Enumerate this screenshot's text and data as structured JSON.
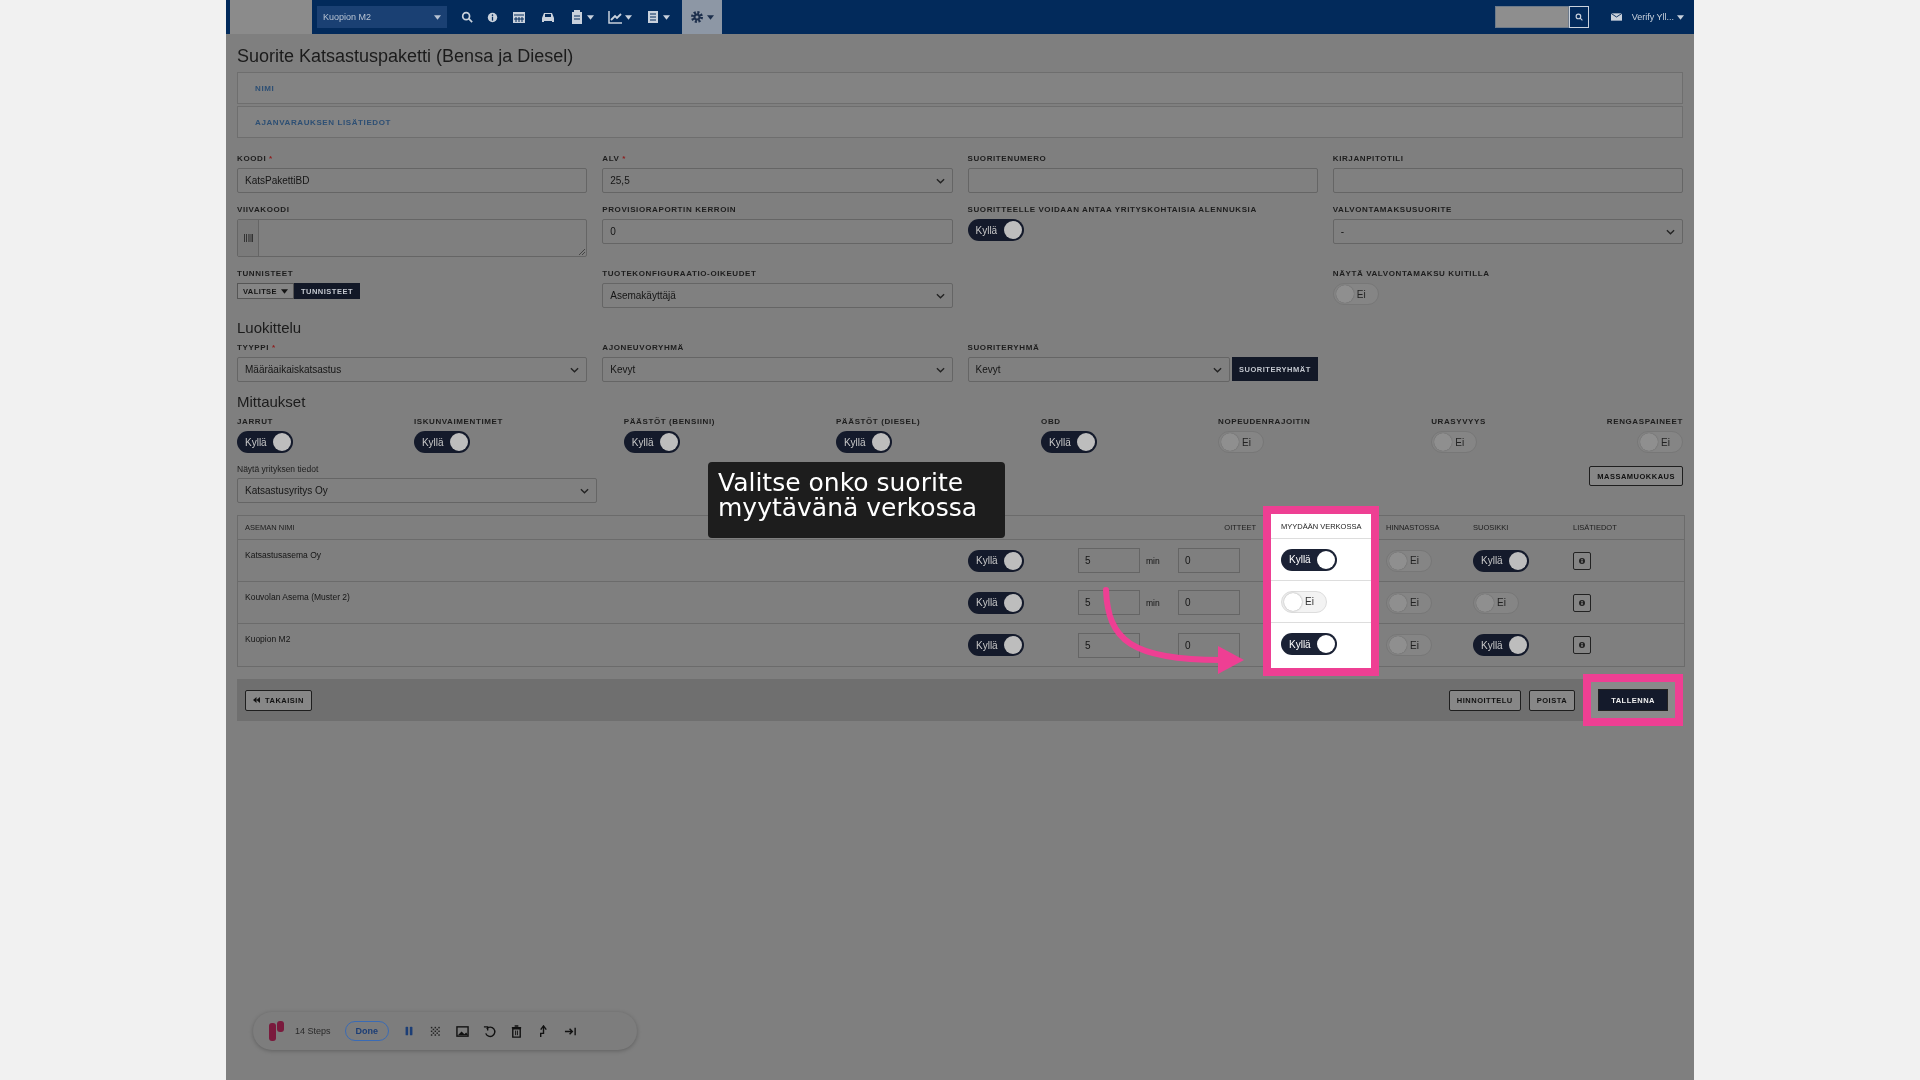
{
  "topbar": {
    "location": "Kuopion M2",
    "user": "Verify Yll..."
  },
  "title": "Suorite Katsastuspaketti (Bensa ja Diesel)",
  "panels": [
    {
      "label": "NIMI"
    },
    {
      "label": "AJANVARAUKSEN LISÄTIEDOT"
    }
  ],
  "fields": [
    {
      "kind": "input",
      "label": "KOODI",
      "required_mark": "*",
      "value": "KatsPakettiBD"
    },
    {
      "kind": "select",
      "label": "ALV",
      "required_mark": "*",
      "value": "25,5"
    },
    {
      "kind": "input",
      "label": "SUORITENUMERO"
    },
    {
      "kind": "input",
      "label": "KIRJANPITOTILI"
    },
    {
      "kind": "barcode",
      "label": "VIIVAKOODI"
    },
    {
      "kind": "input",
      "label": "PROVISIORAPORTIN KERROIN",
      "value": "0"
    },
    {
      "kind": "toggle",
      "label": "SUORITTEELLE VOIDAAN ANTAA YRITYSKOHTAISIA ALENNUKSIA",
      "toggle": {
        "on": true,
        "text": "Kyllä"
      }
    },
    {
      "kind": "select",
      "label": "VALVONTAMAKSUSUORITE",
      "value": "-"
    },
    {
      "kind": "tags",
      "label": "TUNNISTEET",
      "picker": "VALITSE",
      "button": "TUNNISTEET"
    },
    {
      "kind": "select",
      "label": "TUOTEKONFIGURAATIO-OIKEUDET",
      "value": "Asemakäyttäjä"
    },
    {
      "kind": "empty"
    },
    {
      "kind": "toggle",
      "label": "NÄYTÄ VALVONTAMAKSU KUITILLA",
      "toggle": {
        "on": false,
        "text": "Ei"
      }
    }
  ],
  "classification": {
    "heading": "Luokittelu",
    "fields": [
      {
        "kind": "select",
        "label": "TYYPPI",
        "required_mark": "*",
        "value": "Määräaikaiskatsastus"
      },
      {
        "kind": "select",
        "label": "AJONEUVORYHMÄ",
        "value": "Kevyt"
      },
      {
        "kind": "select",
        "label": "SUORITERYHMÄ",
        "value": "Kevyt",
        "button": "SUORITERYHMÄT"
      }
    ]
  },
  "measurements": {
    "heading": "Mittaukset",
    "items": [
      {
        "label": "JARRUT",
        "on": true,
        "text": "Kyllä"
      },
      {
        "label": "ISKUNVAIMENTIMET",
        "on": true,
        "text": "Kyllä"
      },
      {
        "label": "PÄÄSTÖT (BENSIINI)",
        "on": true,
        "text": "Kyllä"
      },
      {
        "label": "PÄÄSTÖT (DIESEL)",
        "on": true,
        "text": "Kyllä"
      },
      {
        "label": "OBD",
        "on": true,
        "text": "Kyllä"
      },
      {
        "label": "NOPEUDENRAJOITIN",
        "on": false,
        "text": "Ei"
      },
      {
        "label": "URASYVYYS",
        "on": false,
        "text": "Ei"
      },
      {
        "label": "RENGASPAINEET",
        "on": false,
        "text": "Ei"
      }
    ]
  },
  "company": {
    "label": "Näytä yrityksen tiedot",
    "value": "Katsastusyritys Oy",
    "bulk_button": "MASSAMUOKKAUS"
  },
  "table": {
    "columns": [
      {
        "kind": "name",
        "label": "ASEMAN NIMI"
      },
      {
        "kind": "active"
      },
      {
        "kind": "minutes"
      },
      {
        "kind": "number",
        "label": "OITTEET"
      },
      {
        "kind": "online",
        "label": "MYYDÄÄN VERKOSSA",
        "highlighted": true
      },
      {
        "kind": "pricelist",
        "label": "HINNASTOSSA"
      },
      {
        "kind": "favorite",
        "label": "SUOSIKKI"
      },
      {
        "kind": "info",
        "label": "LISÄTIEDOT"
      }
    ],
    "rows": [
      {
        "name": "Katsastusasema Oy",
        "active": {
          "on": true,
          "text": "Kyllä"
        },
        "minutes": "5",
        "unit": "min",
        "number": "0",
        "online": {
          "on": true,
          "text": "Kyllä"
        },
        "pricelist": {
          "on": false,
          "text": "Ei"
        },
        "favorite": {
          "on": true,
          "text": "Kyllä"
        }
      },
      {
        "name": "Kouvolan Asema (Muster 2)",
        "active": {
          "on": true,
          "text": "Kyllä"
        },
        "minutes": "5",
        "unit": "min",
        "number": "0",
        "online": {
          "on": false,
          "text": "Ei"
        },
        "pricelist": {
          "on": false,
          "text": "Ei"
        },
        "favorite": {
          "on": false,
          "text": "Ei"
        }
      },
      {
        "name": "Kuopion M2",
        "active": {
          "on": true,
          "text": "Kyllä"
        },
        "minutes": "5",
        "number": "0",
        "online": {
          "on": true,
          "text": "Kyllä"
        },
        "pricelist": {
          "on": false,
          "text": "Ei"
        },
        "favorite": {
          "on": true,
          "text": "Kyllä"
        }
      }
    ]
  },
  "footer": {
    "back": "TAKAISIN",
    "buttons": [
      {
        "label": "HINNOITTELU",
        "kind": "outline",
        "highlighted": false
      },
      {
        "label": "POISTA",
        "kind": "outline",
        "highlighted": false
      },
      {
        "label": "TALLENNA",
        "kind": "primary",
        "highlighted": true
      }
    ]
  },
  "tutorial": {
    "tooltip": "Valitse onko suorite myytävänä verkossa"
  },
  "recorder": {
    "steps": "14 Steps",
    "status": "Done"
  }
}
